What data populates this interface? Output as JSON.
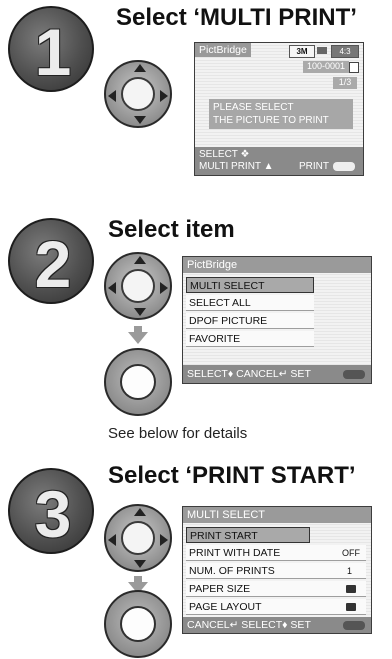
{
  "step1": {
    "number": "1",
    "title": "Select ‘MULTI PRINT’",
    "screen": {
      "header": "PictBridge",
      "badge_size": "3M",
      "badge_ratio": "4:3",
      "folder": "100-0001",
      "counter": "1/3",
      "message_line1": "PLEASE SELECT",
      "message_line2": "THE PICTURE TO PRINT",
      "footer_line1": "SELECT ❖",
      "footer_line2_left": "MULTI PRINT ▲",
      "footer_line2_right": "PRINT"
    }
  },
  "step2": {
    "number": "2",
    "title": "Select item",
    "screen": {
      "header": "PictBridge",
      "items": [
        "MULTI SELECT",
        "SELECT ALL",
        "DPOF PICTURE",
        "FAVORITE"
      ],
      "footer": "SELECT♦ CANCEL↵ SET"
    }
  },
  "caption": "See below for details",
  "step3": {
    "number": "3",
    "title": "Select ‘PRINT START’",
    "screen": {
      "header": "MULTI SELECT",
      "items": [
        {
          "label": "PRINT START",
          "value": ""
        },
        {
          "label": "PRINT WITH DATE",
          "value": "OFF"
        },
        {
          "label": "NUM. OF PRINTS",
          "value": "1"
        },
        {
          "label": "PAPER SIZE",
          "value": "printer-icon"
        },
        {
          "label": "PAGE LAYOUT",
          "value": "printer-icon"
        }
      ],
      "footer": "CANCEL↵ SELECT♦ SET"
    }
  }
}
